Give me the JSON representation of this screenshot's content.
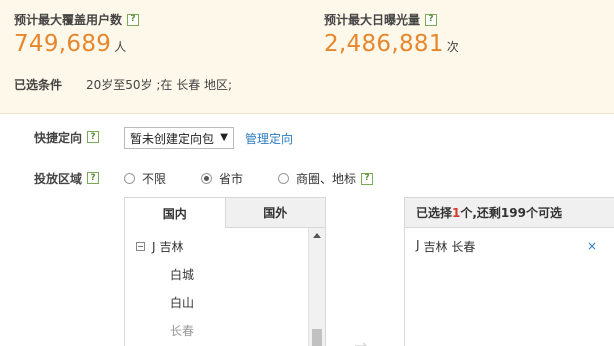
{
  "summary": {
    "users_label": "预计最大覆盖用户数",
    "users_value": "749,689",
    "users_unit": "人",
    "impr_label": "预计最大日曝光量",
    "impr_value": "2,486,881",
    "impr_unit": "次",
    "cond_label": "已选条件",
    "cond_text": "20岁至50岁 ;在 长春 地区;",
    "help_glyph": "?"
  },
  "quick": {
    "label": "快捷定向",
    "select_value": "暂未创建定向包",
    "manage_link": "管理定向"
  },
  "region": {
    "label": "投放区域",
    "options": [
      {
        "label": "不限",
        "selected": false
      },
      {
        "label": "省市",
        "selected": true
      },
      {
        "label": "商圈、地标",
        "selected": false
      }
    ]
  },
  "tree": {
    "tabs": [
      "国内",
      "国外"
    ],
    "active_tab": "国内",
    "expand_glyph": "−",
    "root_prefix": "J",
    "root": "吉林",
    "children": [
      "白城",
      "白山",
      "长春"
    ]
  },
  "selected": {
    "head_prefix": "已选择",
    "head_count": "1",
    "head_suffix": "个,还剩199个可选",
    "item_prefix": "J",
    "item": "吉林 长春",
    "remove_glyph": "×"
  },
  "colors": {
    "accent_number": "#e6872d",
    "link": "#2c7bbf",
    "count_red": "#d23b2c",
    "summary_bg": "#fdf8e9"
  },
  "icons": {
    "help": "question-mark-icon",
    "dropdown": "caret-down-icon",
    "remove": "close-icon",
    "move": "arrow-right-icon"
  }
}
